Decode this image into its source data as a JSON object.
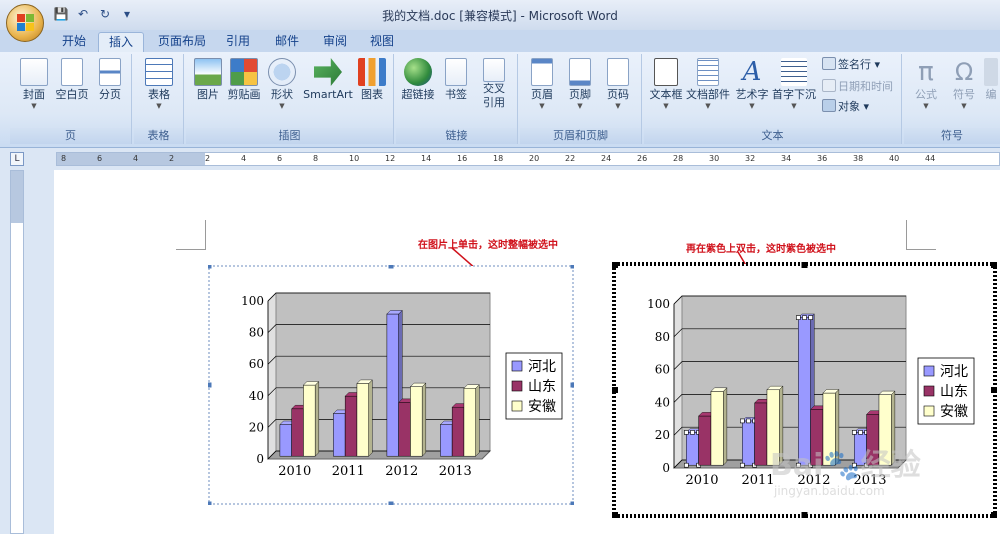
{
  "window": {
    "title": "我的文档.doc [兼容模式] - Microsoft Word"
  },
  "quick_access": {
    "icons": [
      "save-icon",
      "undo-icon",
      "redo-icon",
      "customize-icon"
    ]
  },
  "tabs": [
    {
      "label": "开始",
      "active": false
    },
    {
      "label": "插入",
      "active": true
    },
    {
      "label": "页面布局",
      "active": false
    },
    {
      "label": "引用",
      "active": false
    },
    {
      "label": "邮件",
      "active": false
    },
    {
      "label": "审阅",
      "active": false
    },
    {
      "label": "视图",
      "active": false
    }
  ],
  "ribbon": {
    "groups": {
      "page": {
        "label": "页",
        "buttons": [
          "封面",
          "空白页",
          "分页"
        ]
      },
      "table": {
        "label": "表格",
        "buttons": [
          "表格"
        ]
      },
      "illustrations": {
        "label": "插图",
        "buttons": [
          "图片",
          "剪贴画",
          "形状",
          "SmartArt",
          "图表"
        ]
      },
      "links": {
        "label": "链接",
        "buttons": [
          "超链接",
          "书签",
          "交叉",
          "引用"
        ]
      },
      "header_footer": {
        "label": "页眉和页脚",
        "buttons": [
          "页眉",
          "页脚",
          "页码"
        ]
      },
      "text": {
        "label": "文本",
        "buttons": [
          "文本框",
          "文档部件",
          "艺术字",
          "首字下沉"
        ],
        "small": [
          "签名行",
          "日期和时间",
          "对象"
        ]
      },
      "symbols": {
        "label": "符号",
        "buttons": [
          "公式",
          "符号",
          "编"
        ]
      }
    }
  },
  "ruler": {
    "h_ticks": [
      "8",
      "6",
      "4",
      "2",
      "2",
      "4",
      "6",
      "8",
      "10",
      "12",
      "14",
      "16",
      "18",
      "20",
      "22",
      "24",
      "26",
      "28",
      "30",
      "32",
      "34",
      "36",
      "38",
      "40",
      "44"
    ],
    "corner": "L"
  },
  "annotations": {
    "left": "在图片上单击，这时整幅被选中",
    "right": "再在紫色上双击，这时紫色被选中"
  },
  "watermark": {
    "brand": "Bai",
    "brand_cn": "经验",
    "url": "jingyan.baidu.com"
  },
  "colors": {
    "series1": "#9999ff",
    "series2": "#993366",
    "series3": "#ffffcc",
    "plot_bg": "#c0c0c0"
  },
  "chart_data": [
    {
      "type": "bar",
      "categories": [
        "2010",
        "2011",
        "2012",
        "2013"
      ],
      "series": [
        {
          "name": "河北",
          "values": [
            20,
            27,
            90,
            20
          ]
        },
        {
          "name": "山东",
          "values": [
            30,
            38,
            34,
            31
          ]
        },
        {
          "name": "安徽",
          "values": [
            45,
            46,
            44,
            43
          ]
        }
      ],
      "yticks": [
        "0",
        "20",
        "40",
        "60",
        "80",
        "100"
      ],
      "ylim": [
        0,
        100
      ],
      "grid": true,
      "legend": "right",
      "title": "",
      "xlabel": "",
      "ylabel": "",
      "selection": "whole chart"
    },
    {
      "type": "bar",
      "categories": [
        "2010",
        "2011",
        "2012",
        "2013"
      ],
      "series": [
        {
          "name": "河北",
          "values": [
            20,
            27,
            90,
            20
          ]
        },
        {
          "name": "山东",
          "values": [
            30,
            38,
            34,
            31
          ]
        },
        {
          "name": "安徽",
          "values": [
            45,
            46,
            44,
            43
          ]
        }
      ],
      "yticks": [
        "0",
        "20",
        "40",
        "60",
        "80",
        "100"
      ],
      "ylim": [
        0,
        100
      ],
      "grid": true,
      "legend": "right",
      "title": "",
      "xlabel": "",
      "ylabel": "",
      "selection": "series 河北"
    }
  ]
}
